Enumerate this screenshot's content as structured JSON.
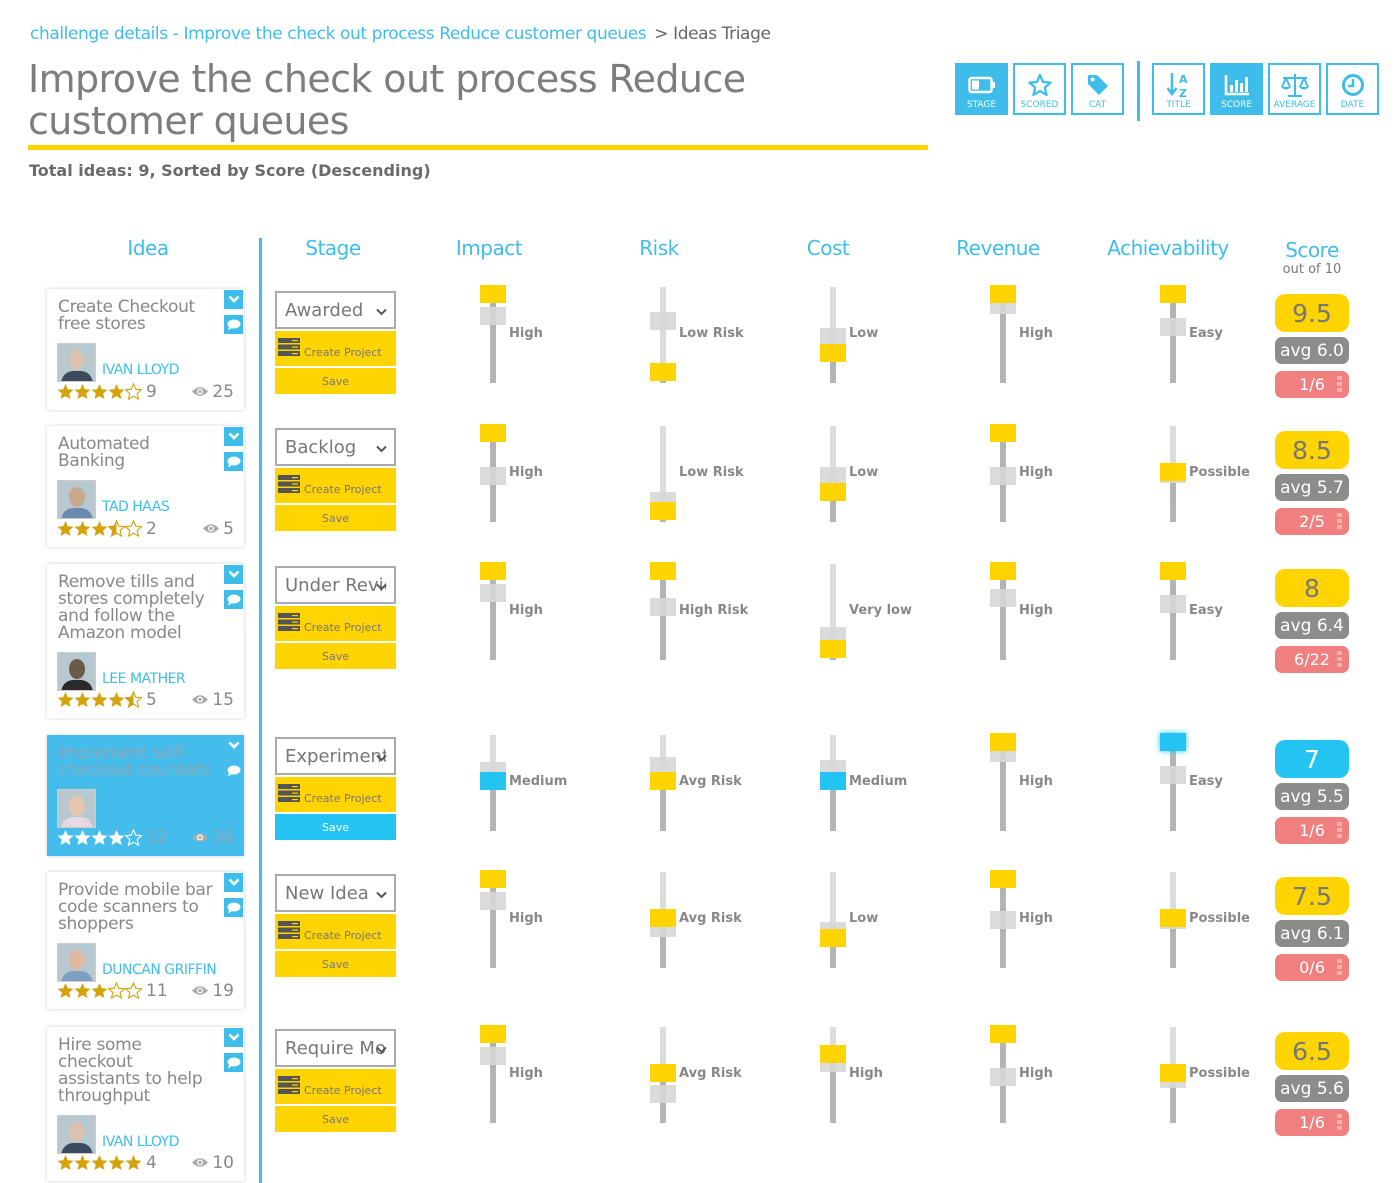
{
  "breadcrumb": {
    "link": "challenge details - Improve the check out process Reduce customer queues",
    "current": "> Ideas Triage"
  },
  "page_title": "Improve the check out process Reduce customer queues",
  "summary": "Total ideas: 9, Sorted by Score (Descending)",
  "colors": {
    "accent": "#3fbdea",
    "yellow": "#ffd400",
    "selected_blue": "#23c4f2",
    "avg_grey": "#8c8c8a",
    "rank_red": "#f08080"
  },
  "toolbar": {
    "filters": [
      {
        "label": "STAGE",
        "icon": "battery-icon",
        "active": true
      },
      {
        "label": "SCORED",
        "icon": "star-icon",
        "active": false
      },
      {
        "label": "CAT",
        "icon": "tag-icon",
        "active": false
      }
    ],
    "sorts": [
      {
        "label": "TITLE",
        "icon": "sort-alpha-icon",
        "active": false
      },
      {
        "label": "SCORE",
        "icon": "bar-chart-icon",
        "active": true
      },
      {
        "label": "AVERAGE",
        "icon": "scales-icon",
        "active": false
      },
      {
        "label": "DATE",
        "icon": "clock-icon",
        "active": false
      }
    ]
  },
  "columns": {
    "idea": "Idea",
    "stage": "Stage",
    "impact": "Impact",
    "risk": "Risk",
    "cost": "Cost",
    "revenue": "Revenue",
    "achievability": "Achievability",
    "score": "Score",
    "score_sub": "out of 10"
  },
  "labels": {
    "create_project": "Create Project",
    "save": "Save"
  },
  "ideas": [
    {
      "title": "Create Checkout free stores",
      "author": "IVAN LLOYD",
      "stars": 4,
      "rating_count": "9",
      "views": "25",
      "stage": "Awarded",
      "selected": false,
      "criteria": {
        "impact": {
          "label": "High",
          "value": 1.0,
          "avg": 0.75
        },
        "risk": {
          "label": "Low Risk",
          "value": 0.0,
          "avg": 0.68
        },
        "cost": {
          "label": "Low",
          "value": 0.25,
          "avg": 0.47
        },
        "revenue": {
          "label": "High",
          "value": 1.0,
          "avg": 0.88
        },
        "achievability": {
          "label": "Easy",
          "value": 1.0,
          "avg": 0.6
        }
      },
      "score": "9.5",
      "avg": "avg 6.0",
      "rank": "1/6"
    },
    {
      "title": "Automated Banking",
      "author": "TAD HAAS",
      "stars": 3.5,
      "rating_count": "2",
      "views": "5",
      "stage": "Backlog",
      "selected": false,
      "criteria": {
        "impact": {
          "label": "High",
          "value": 1.0,
          "avg": 0.47
        },
        "risk": {
          "label": "Low Risk",
          "value": 0.0,
          "avg": 0.15
        },
        "cost": {
          "label": "Low",
          "value": 0.25,
          "avg": 0.47
        },
        "revenue": {
          "label": "High",
          "value": 1.0,
          "avg": 0.47
        },
        "achievability": {
          "label": "Possible",
          "value": 0.5,
          "avg": 0.5
        }
      },
      "score": "8.5",
      "avg": "avg 5.7",
      "rank": "2/5"
    },
    {
      "title": "Remove tills and stores completely and follow the Amazon model",
      "author": "LEE MATHER",
      "stars": 4.5,
      "rating_count": "5",
      "views": "15",
      "stage": "Under Review",
      "selected": false,
      "criteria": {
        "impact": {
          "label": "High",
          "value": 1.0,
          "avg": 0.75
        },
        "risk": {
          "label": "High Risk",
          "value": 1.0,
          "avg": 0.56
        },
        "cost": {
          "label": "Very low",
          "value": 0.0,
          "avg": 0.19
        },
        "revenue": {
          "label": "High",
          "value": 1.0,
          "avg": 0.68
        },
        "achievability": {
          "label": "Easy",
          "value": 1.0,
          "avg": 0.6
        }
      },
      "score": "8",
      "avg": "avg 6.4",
      "rank": "6/22"
    },
    {
      "title": "Implement self-checkout counters",
      "author": "",
      "stars": 4,
      "rating_count": "12",
      "views": "36",
      "stage": "Experimental",
      "selected": true,
      "criteria": {
        "impact": {
          "label": "Medium",
          "value": 0.5,
          "avg": 0.65
        },
        "risk": {
          "label": "Avg Risk",
          "value": 0.5,
          "avg": 0.72
        },
        "cost": {
          "label": "Medium",
          "value": 0.5,
          "avg": 0.68
        },
        "revenue": {
          "label": "High",
          "value": 1.0,
          "avg": 0.88
        },
        "achievability": {
          "label": "Easy",
          "value": 1.0,
          "avg": 0.6
        }
      },
      "score": "7",
      "avg": "avg 5.5",
      "rank": "1/6"
    },
    {
      "title": "Provide mobile bar code scanners to shoppers",
      "author": "DUNCAN GRIFFIN",
      "stars": 3,
      "rating_count": "11",
      "views": "19",
      "stage": "New Idea",
      "selected": false,
      "criteria": {
        "impact": {
          "label": "High",
          "value": 1.0,
          "avg": 0.75
        },
        "risk": {
          "label": "Avg Risk",
          "value": 0.5,
          "avg": 0.4
        },
        "cost": {
          "label": "Low",
          "value": 0.25,
          "avg": 0.36
        },
        "revenue": {
          "label": "High",
          "value": 1.0,
          "avg": 0.5
        },
        "achievability": {
          "label": "Possible",
          "value": 0.5,
          "avg": 0.5
        }
      },
      "score": "7.5",
      "avg": "avg 6.1",
      "rank": "0/6"
    },
    {
      "title": "Hire some checkout assistants to help throughput",
      "author": "IVAN LLOYD",
      "stars": 5,
      "rating_count": "4",
      "views": "10",
      "stage": "Require More Info",
      "selected": false,
      "criteria": {
        "impact": {
          "label": "High",
          "value": 1.0,
          "avg": 0.75
        },
        "risk": {
          "label": "Avg Risk",
          "value": 0.5,
          "avg": 0.26
        },
        "cost": {
          "label": "High",
          "value": 0.75,
          "avg": 0.65
        },
        "revenue": {
          "label": "High",
          "value": 1.0,
          "avg": 0.47
        },
        "achievability": {
          "label": "Possible",
          "value": 0.5,
          "avg": 0.45
        }
      },
      "score": "6.5",
      "avg": "avg 5.6",
      "rank": "1/6"
    }
  ]
}
